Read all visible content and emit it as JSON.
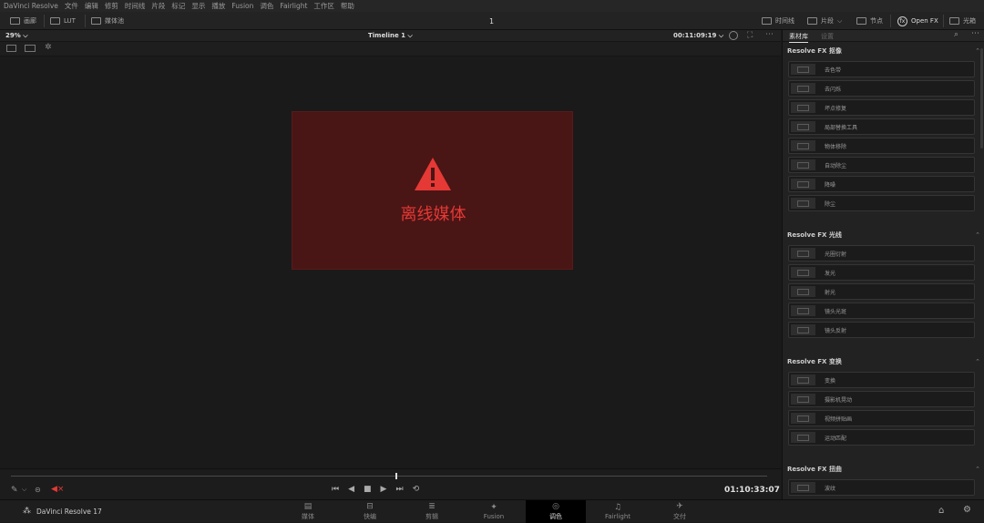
{
  "menubar": {
    "items": [
      "DaVinci Resolve",
      "文件",
      "编辑",
      "修剪",
      "时间线",
      "片段",
      "标记",
      "显示",
      "播放",
      "Fusion",
      "调色",
      "Fairlight",
      "工作区",
      "帮助"
    ]
  },
  "toolbar": {
    "gallery": "画廊",
    "lut": "LUT",
    "media_pool": "媒体池",
    "title": "1",
    "timeline": "时间线",
    "clips": "片段",
    "nodes": "节点",
    "openfx": "Open FX",
    "lightbox": "光箱"
  },
  "viewer": {
    "zoom": "29%",
    "timeline_name": "Timeline 1",
    "timecode_top": "00:11:09:19",
    "offline_text": "离线媒体",
    "offline_color": "#e53935",
    "offline_bg": "#4a1515"
  },
  "transport": {
    "timecode": "01:10:33:07"
  },
  "panel": {
    "tabs": [
      "素材库",
      "设置"
    ],
    "sections": [
      {
        "title": "Resolve FX 抠像",
        "items": [
          "去色带",
          "去闪烁",
          "坏点修复",
          "局部替换工具",
          "物体移除",
          "自动除尘",
          "降噪",
          "除尘"
        ]
      },
      {
        "title": "Resolve FX 光线",
        "items": [
          "光圈衍射",
          "发光",
          "射光",
          "镜头光斑",
          "镜头反射"
        ]
      },
      {
        "title": "Resolve FX 变换",
        "items": [
          "变换",
          "摄影机晃动",
          "视频拼贴画",
          "运动匹配"
        ]
      },
      {
        "title": "Resolve FX 扭曲",
        "items": [
          "波纹"
        ]
      }
    ]
  },
  "pagebar": {
    "app_name": "DaVinci Resolve 17",
    "pages": [
      {
        "label": "媒体",
        "icon": "media-page-icon"
      },
      {
        "label": "快编",
        "icon": "cut-page-icon"
      },
      {
        "label": "剪辑",
        "icon": "edit-page-icon"
      },
      {
        "label": "Fusion",
        "icon": "fusion-page-icon"
      },
      {
        "label": "调色",
        "icon": "color-page-icon"
      },
      {
        "label": "Fairlight",
        "icon": "fairlight-page-icon"
      },
      {
        "label": "交付",
        "icon": "deliver-page-icon"
      }
    ],
    "active_page": "调色"
  },
  "colors": {
    "accent": "#e53935",
    "active_tab_underline": "#e0e0e0"
  }
}
